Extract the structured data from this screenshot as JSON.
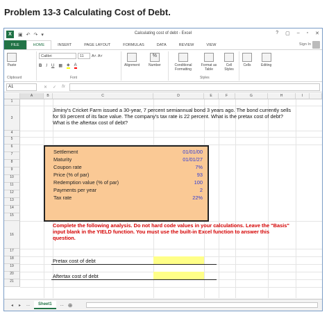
{
  "problem": {
    "title": "Problem 13-3 Calculating Cost of Debt."
  },
  "window": {
    "title": "Calculating cost of debt - Excel",
    "controls": [
      "?",
      "▢",
      "–",
      "▫",
      "✕"
    ]
  },
  "ribbon": {
    "tabs": [
      "FILE",
      "HOME",
      "INSERT",
      "PAGE LAYOUT",
      "FORMULAS",
      "DATA",
      "REVIEW",
      "VIEW"
    ],
    "active_tab": "HOME",
    "signin": "Sign In",
    "font_name": "Calibri",
    "font_size": "11",
    "labels": {
      "paste": "Paste",
      "clipboard": "Clipboard",
      "font": "Font",
      "alignment": "Alignment",
      "number": "Number",
      "conditional": "Conditional Formatting",
      "format_table": "Format as Table",
      "cell_styles": "Cell Styles",
      "cells": "Cells",
      "editing": "Editing",
      "styles": "Styles"
    },
    "format_buttons": [
      "B",
      "I",
      "U"
    ],
    "percent": "%"
  },
  "formula_bar": {
    "name_box": "A1",
    "fx": "fx",
    "value": ""
  },
  "columns": [
    "A",
    "B",
    "C",
    "D",
    "E",
    "F",
    "G",
    "H",
    "I"
  ],
  "rows": [
    "1",
    "3",
    "4",
    "5",
    "6",
    "7",
    "8",
    "9",
    "10",
    "11",
    "12",
    "13",
    "14",
    "15",
    "16",
    "17",
    "18",
    "19",
    "20",
    "21"
  ],
  "sheet": {
    "intro": "Jiminy's Cricket Farm issued a 30-year, 7 percent semiannual bond 3 years ago. The bond currently sells for 93 percent of its face value. The company's tax rate is 22 percent. What is the pretax cost of debt? What is the aftertax cost of debt?",
    "data": [
      {
        "label": "Settlement",
        "value": "01/01/00"
      },
      {
        "label": "Maturity",
        "value": "01/01/27"
      },
      {
        "label": "Coupon rate",
        "value": "7%"
      },
      {
        "label": "Price (% of par)",
        "value": "93"
      },
      {
        "label": "Redemption value (% of par)",
        "value": "100"
      },
      {
        "label": "Payments per year",
        "value": "2"
      },
      {
        "label": "Tax rate",
        "value": "22%"
      }
    ],
    "instructions": "Complete the following analysis. Do not hard code values in your calculations. Leave the \"Basis\" input blank in the YIELD function. You must use the built-in Excel function to answer this question.",
    "pretax_label": "Pretax cost of debt",
    "aftertax_label": "Aftertax cost of debt"
  },
  "sheet_tabs": {
    "nav": [
      "◂",
      "▸",
      "..."
    ],
    "active": "Sheet1",
    "more": "...",
    "add": "⊕"
  }
}
